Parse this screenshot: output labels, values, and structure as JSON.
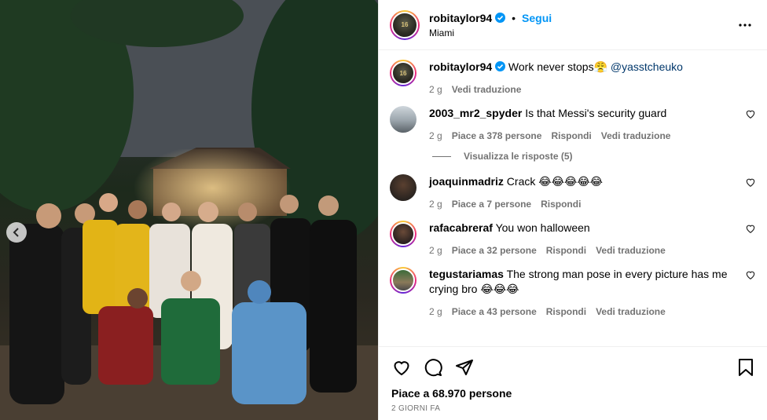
{
  "post": {
    "username": "robitaylor94",
    "follow_label": "Segui",
    "location": "Miami",
    "caption_text": "Work never stops😤",
    "caption_mention": "@yasstcheuko",
    "caption_time": "2 g",
    "caption_translate": "Vedi traduzione",
    "likes": "Piace a 68.970 persone",
    "posted": "2 GIORNI FA"
  },
  "comments": [
    {
      "username": "2003_mr2_spyder",
      "text": "Is that Messi's security guard",
      "time": "2 g",
      "likes": "Piace a 378 persone",
      "reply": "Rispondi",
      "translate": "Vedi traduzione",
      "replies": "Visualizza le risposte (5)"
    },
    {
      "username": "joaquinmadriz",
      "text": "Crack 😂😂😂😂😂",
      "time": "2 g",
      "likes": "Piace a 7 persone",
      "reply": "Rispondi"
    },
    {
      "username": "rafacabreraf",
      "text": "You won halloween",
      "time": "2 g",
      "likes": "Piace a 32 persone",
      "reply": "Rispondi",
      "translate": "Vedi traduzione"
    },
    {
      "username": "tegustariamas",
      "text": "The strong man pose in every picture has me crying bro 😂😂😂",
      "time": "2 g",
      "likes": "Piace a 43 persone",
      "reply": "Rispondi",
      "translate": "Vedi traduzione"
    }
  ],
  "icons": {
    "more": "more-options-icon",
    "like": "heart-icon",
    "comment": "comment-icon",
    "share": "share-icon",
    "save": "bookmark-icon",
    "verified": "verified-badge-icon",
    "prev": "chevron-left-icon"
  },
  "colors": {
    "accent": "#0095f6",
    "muted": "#737373",
    "mention": "#00376b"
  }
}
